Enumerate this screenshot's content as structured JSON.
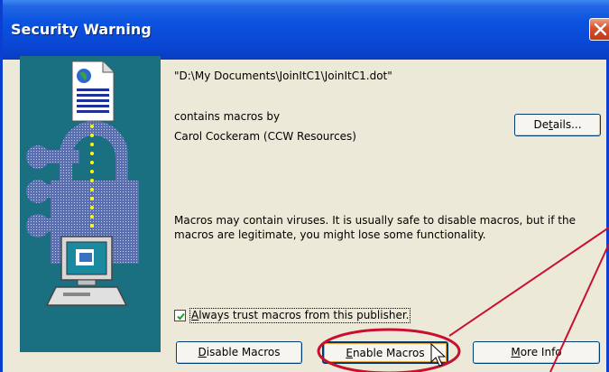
{
  "window": {
    "title": "Security Warning"
  },
  "dialog": {
    "file_path": "\"D:\\My Documents\\JoinItC1\\JoinItC1.dot\"",
    "contains_line": "contains macros by",
    "publisher": "Carol Cockeram (CCW Resources)",
    "warning_line1": "Macros may contain viruses. It is usually safe to disable macros, but if the",
    "warning_line2": "macros are legitimate, you might lose some functionality.",
    "details_button": {
      "pre": "De",
      "key": "t",
      "post": "ails..."
    },
    "trust_checkbox": {
      "checked": true,
      "key": "A",
      "post": "lways trust macros from this publisher."
    },
    "disable_button": {
      "key": "D",
      "post": "isable Macros"
    },
    "enable_button": {
      "key": "E",
      "post": "nable Macros"
    },
    "more_info_button": {
      "key": "M",
      "post": "ore Info"
    }
  },
  "colors": {
    "titlebar": "#0a54e0",
    "close_button": "#d5502b",
    "dialog_bg": "#ece9d8",
    "side_panel": "#1a7080",
    "annotation": "#c8102e"
  },
  "icons": [
    "document-icon",
    "padlock-icon",
    "computer-icon",
    "close-icon",
    "mouse-cursor-icon"
  ]
}
